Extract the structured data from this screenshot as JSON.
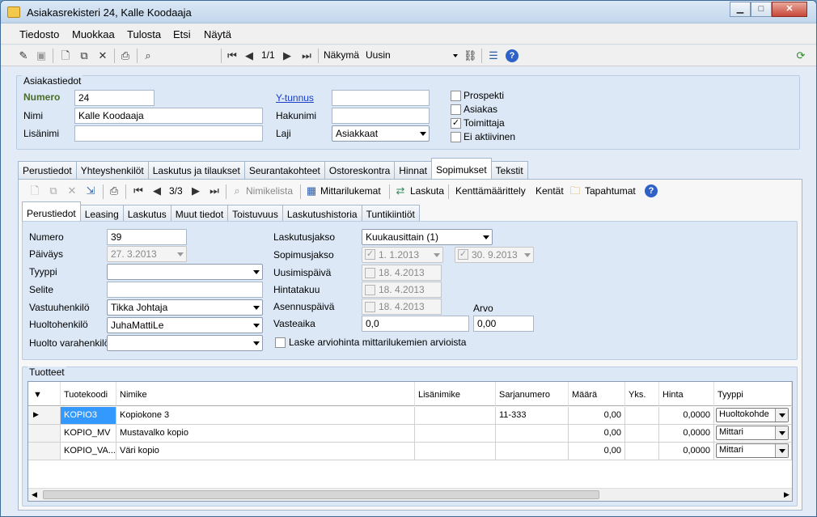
{
  "window": {
    "title": "Asiakasrekisteri 24, Kalle Koodaaja",
    "min": "▁",
    "max": "□",
    "close": "✕"
  },
  "menu": [
    "Tiedosto",
    "Muokkaa",
    "Tulosta",
    "Etsi",
    "Näytä"
  ],
  "toolbar": {
    "record_pos": "1/1",
    "view_label": "Näkymä",
    "view_value": "Uusin"
  },
  "customer": {
    "group_title": "Asiakastiedot",
    "numero_label": "Numero",
    "numero": "24",
    "nimi_label": "Nimi",
    "nimi": "Kalle Koodaaja",
    "lisanimi_label": "Lisänimi",
    "lisanimi": "",
    "ytunnus_label": "Y-tunnus",
    "ytunnus": "",
    "hakunimi_label": "Hakunimi",
    "hakunimi": "",
    "laji_label": "Laji",
    "laji": "Asiakkaat",
    "checks": [
      {
        "label": "Prospekti",
        "checked": false
      },
      {
        "label": "Asiakas",
        "checked": false
      },
      {
        "label": "Toimittaja",
        "checked": true
      },
      {
        "label": "Ei aktiivinen",
        "checked": false
      }
    ]
  },
  "main_tabs": [
    "Perustiedot",
    "Yhteyshenkilöt",
    "Laskutus ja tilaukset",
    "Seurantakohteet",
    "Ostoreskontra",
    "Hinnat",
    "Sopimukset",
    "Tekstit"
  ],
  "main_tab_active": "Sopimukset",
  "sub_toolbar": {
    "record_pos": "3/3",
    "nimikelista": "Nimikelista",
    "mittarilukemat": "Mittarilukemat",
    "laskuta": "Laskuta",
    "kenttamaarittely": "Kenttämäärittely",
    "kentat": "Kentät",
    "tapahtumat": "Tapahtumat"
  },
  "sub_tabs": [
    "Perustiedot",
    "Leasing",
    "Laskutus",
    "Muut tiedot",
    "Toistuvuus",
    "Laskutushistoria",
    "Tuntikiintiöt"
  ],
  "contract": {
    "numero_label": "Numero",
    "numero": "39",
    "paivays_label": "Päiväys",
    "paivays": "27. 3.2013",
    "tyyppi_label": "Tyyppi",
    "tyyppi": "",
    "selite_label": "Selite",
    "selite": "",
    "vastuuhenkilo_label": "Vastuuhenkilö",
    "vastuuhenkilo": "Tikka Johtaja",
    "huoltohenkilo_label": "Huoltohenkilö",
    "huoltohenkilo": "JuhaMattiLe",
    "huolto_varahenkilo_label": "Huolto varahenkilö",
    "huolto_varahenkilo": "",
    "laskutusjakso_label": "Laskutusjakso",
    "laskutusjakso": "Kuukausittain (1)",
    "sopimusjakso_label": "Sopimusjakso",
    "sopimusjakso_start": "1. 1.2013",
    "sopimusjakso_end": "30. 9.2013",
    "uusimispaiva_label": "Uusimispäivä",
    "uusimispaiva": "18. 4.2013",
    "hintatakuu_label": "Hintatakuu",
    "hintatakuu": "18. 4.2013",
    "asennuspaiva_label": "Asennuspäivä",
    "asennuspaiva": "18. 4.2013",
    "arvo_label": "Arvo",
    "arvo": "0,00",
    "vasteaika_label": "Vasteaika",
    "vasteaika": "0,0",
    "laske_label": "Laske arviohinta mittarilukemien arvioista"
  },
  "products": {
    "group_title": "Tuotteet",
    "columns": [
      "Tuotekoodi",
      "Nimike",
      "Lisänimike",
      "Sarjanumero",
      "Määrä",
      "Yks.",
      "Hinta",
      "Tyyppi"
    ],
    "rows": [
      {
        "code": "KOPIO3",
        "name": "Kopiokone 3",
        "extra": "",
        "serial": "11-333",
        "qty": "0,00",
        "unit": "",
        "price": "0,0000",
        "type": "Huoltokohde"
      },
      {
        "code": "KOPIO_MV",
        "name": "Mustavalko kopio",
        "extra": "",
        "serial": "",
        "qty": "0,00",
        "unit": "",
        "price": "0,0000",
        "type": "Mittari"
      },
      {
        "code": "KOPIO_VA...",
        "name": "Väri kopio",
        "extra": "",
        "serial": "",
        "qty": "0,00",
        "unit": "",
        "price": "0,0000",
        "type": "Mittari"
      }
    ]
  }
}
